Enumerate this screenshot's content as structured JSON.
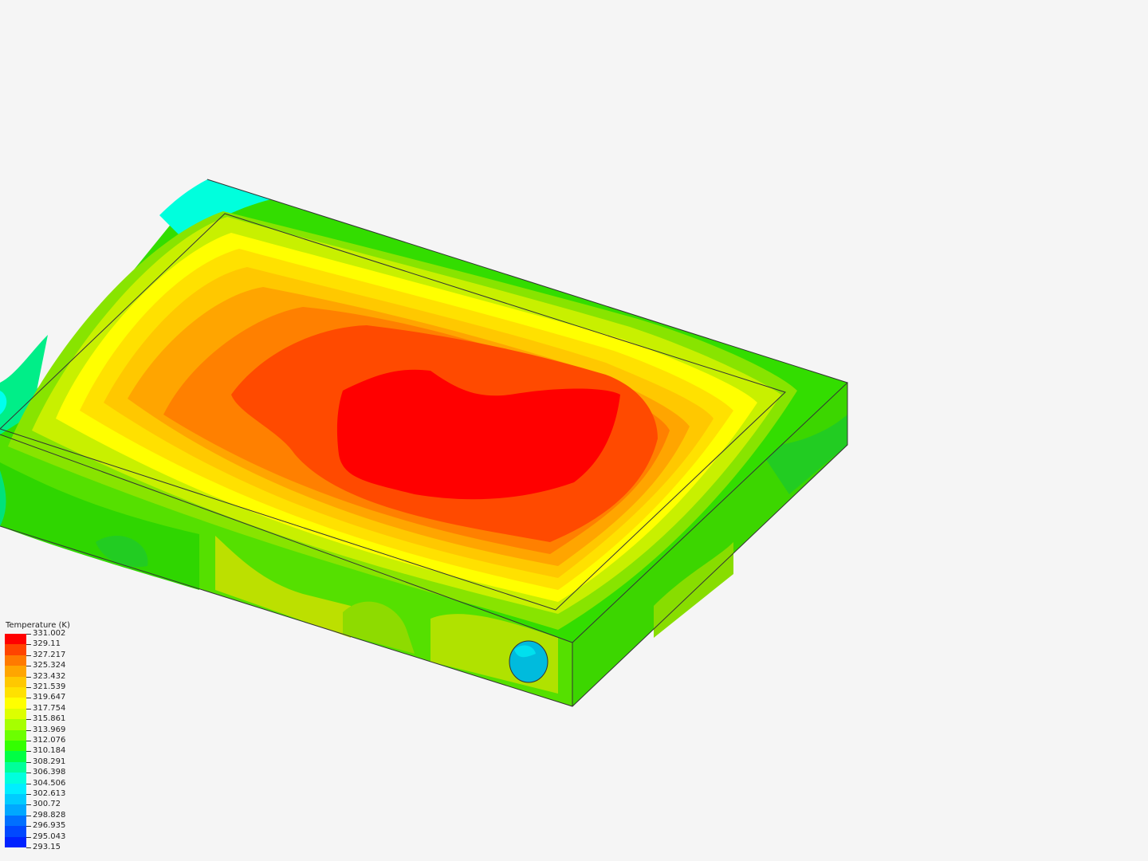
{
  "legend": {
    "title": "Temperature (K)",
    "labels": [
      "331.002",
      "329.11",
      "327.217",
      "325.324",
      "323.432",
      "321.539",
      "319.647",
      "317.754",
      "315.861",
      "313.969",
      "312.076",
      "310.184",
      "308.291",
      "306.398",
      "304.506",
      "302.613",
      "300.72",
      "298.828",
      "296.935",
      "295.043",
      "293.15"
    ],
    "colors": [
      "#ff0000",
      "#ff4400",
      "#ff7a00",
      "#ffa500",
      "#ffc800",
      "#ffe100",
      "#ffff00",
      "#ddff00",
      "#a6ff00",
      "#6cff00",
      "#33ff00",
      "#00ff44",
      "#00ff99",
      "#00ffdd",
      "#00eeff",
      "#00ccff",
      "#00a8ff",
      "#0070ff",
      "#0048ff",
      "#0022ff"
    ]
  },
  "model": {
    "palette": {
      "red": "#ff0000",
      "red_orange": "#ff4a00",
      "orange": "#ff8c00",
      "amber": "#ffb000",
      "gold": "#ffd200",
      "yellow": "#ffff00",
      "yellow_green": "#d8f000",
      "lime": "#99e600",
      "green": "#33dd00",
      "teal": "#00ee88",
      "cyan": "#00ffee",
      "inlet": "#00bbdd"
    }
  }
}
